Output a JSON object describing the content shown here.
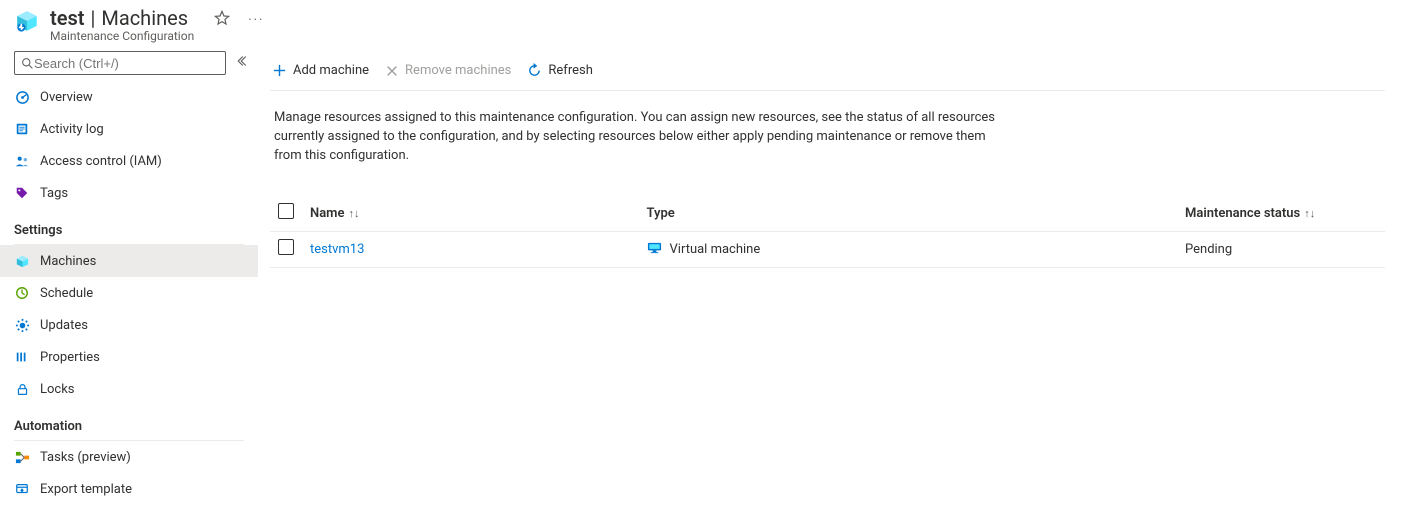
{
  "header": {
    "resource_name": "test",
    "section": "Machines",
    "subtitle": "Maintenance Configuration"
  },
  "sidebar": {
    "search_placeholder": "Search (Ctrl+/)",
    "items": [
      {
        "id": "overview",
        "label": "Overview"
      },
      {
        "id": "activity-log",
        "label": "Activity log"
      },
      {
        "id": "access-control",
        "label": "Access control (IAM)"
      },
      {
        "id": "tags",
        "label": "Tags"
      }
    ],
    "groups": [
      {
        "label": "Settings",
        "items": [
          {
            "id": "machines",
            "label": "Machines",
            "active": true
          },
          {
            "id": "schedule",
            "label": "Schedule"
          },
          {
            "id": "updates",
            "label": "Updates"
          },
          {
            "id": "properties",
            "label": "Properties"
          },
          {
            "id": "locks",
            "label": "Locks"
          }
        ]
      },
      {
        "label": "Automation",
        "items": [
          {
            "id": "tasks",
            "label": "Tasks (preview)"
          },
          {
            "id": "export-template",
            "label": "Export template"
          }
        ]
      }
    ]
  },
  "toolbar": {
    "add_label": "Add machine",
    "remove_label": "Remove machines",
    "refresh_label": "Refresh"
  },
  "description": "Manage resources assigned to this maintenance configuration. You can assign new resources, see the status of all resources currently assigned to the configuration, and by selecting resources below either apply pending maintenance or remove them from this configuration.",
  "table": {
    "columns": {
      "name": "Name",
      "type": "Type",
      "status": "Maintenance status"
    },
    "rows": [
      {
        "name": "testvm13",
        "type": "Virtual machine",
        "status": "Pending"
      }
    ]
  }
}
